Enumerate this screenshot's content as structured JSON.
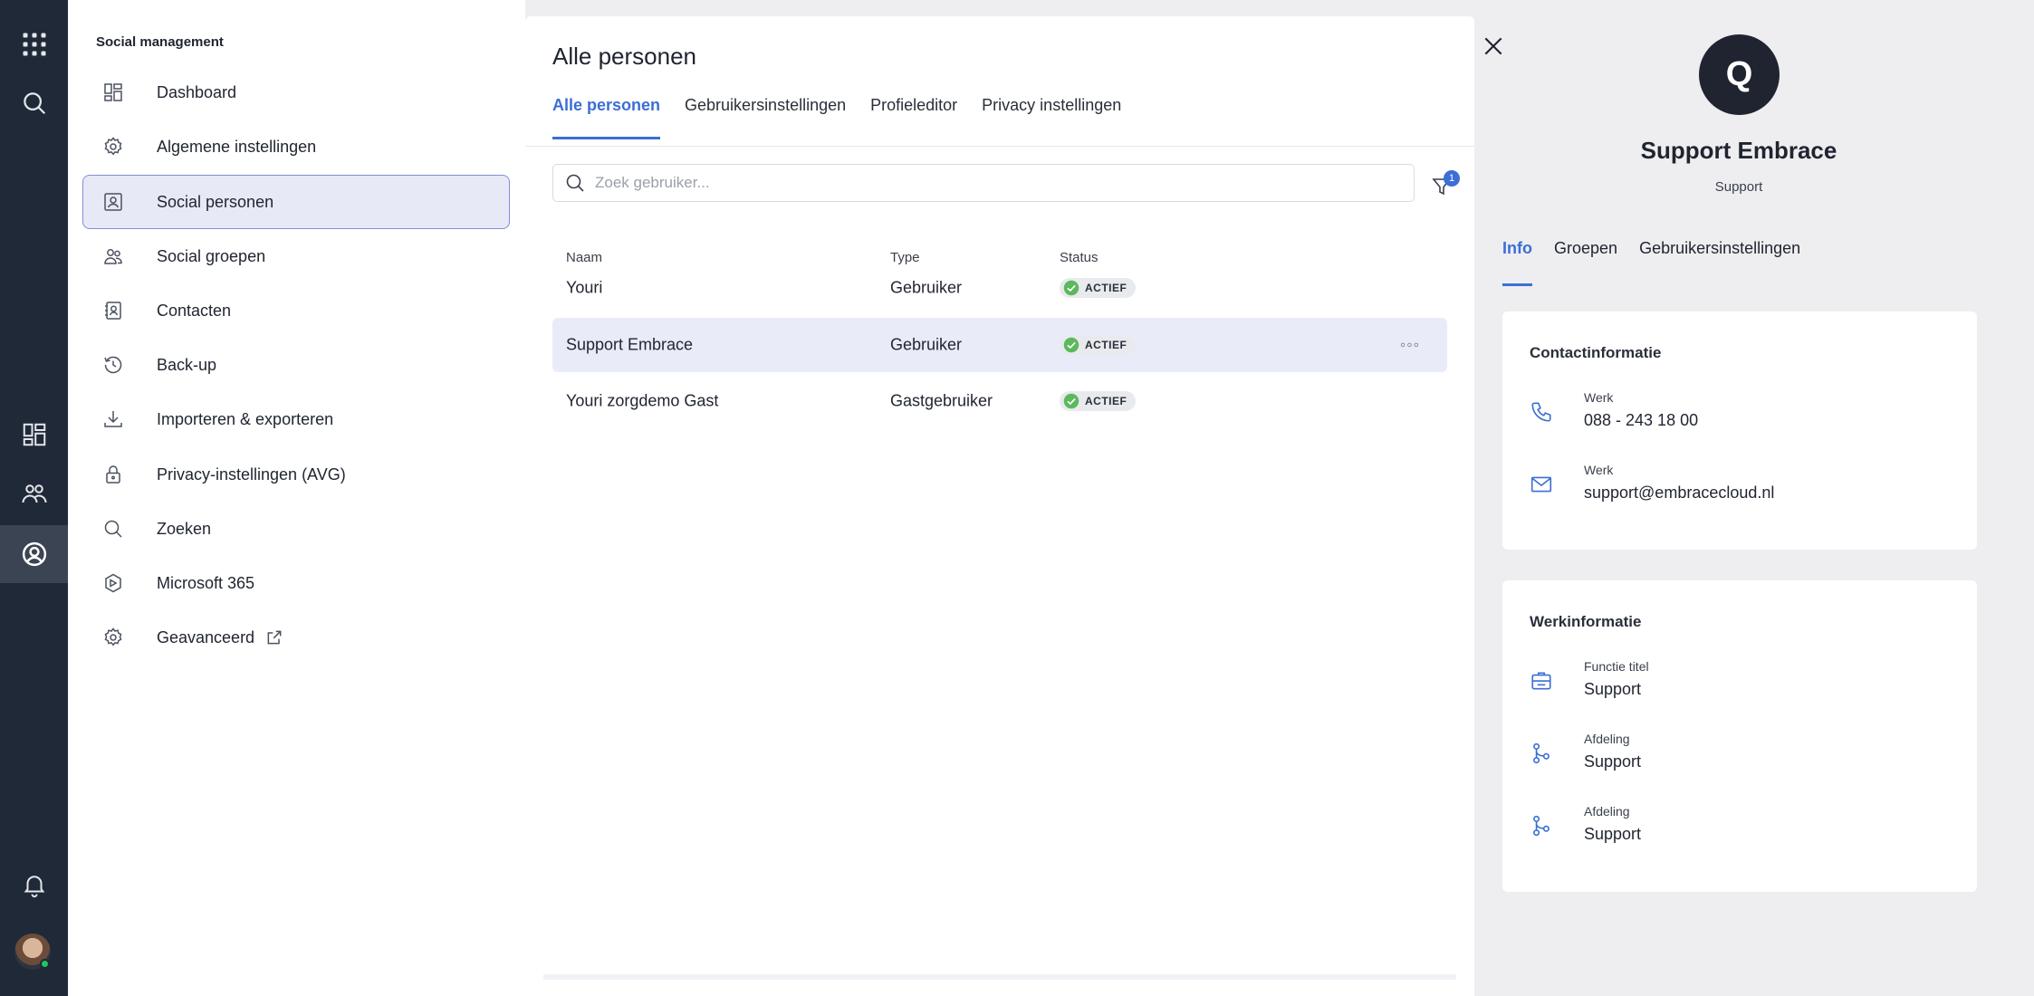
{
  "rail": {
    "items": [
      "apps-icon",
      "search-icon",
      "dashboard-icon",
      "people-icon",
      "social-persons-icon",
      "bell-icon"
    ]
  },
  "sidemenu": {
    "title": "Social management",
    "items": [
      {
        "label": "Dashboard",
        "icon": "dashboard-icon"
      },
      {
        "label": "Algemene instellingen",
        "icon": "gear-icon"
      },
      {
        "label": "Social personen",
        "icon": "person-card-icon",
        "active": true
      },
      {
        "label": "Social groepen",
        "icon": "group-icon"
      },
      {
        "label": "Contacten",
        "icon": "contacts-icon"
      },
      {
        "label": "Back-up",
        "icon": "history-icon"
      },
      {
        "label": "Importeren & exporteren",
        "icon": "download-icon"
      },
      {
        "label": "Privacy-instellingen (AVG)",
        "icon": "lock-icon"
      },
      {
        "label": "Zoeken",
        "icon": "search-icon"
      },
      {
        "label": "Microsoft 365",
        "icon": "m365-icon"
      },
      {
        "label": "Geavanceerd",
        "icon": "gear-icon"
      }
    ]
  },
  "center": {
    "title": "Alle personen",
    "tabs": [
      "Alle personen",
      "Gebruikersinstellingen",
      "Profieleditor",
      "Privacy instellingen"
    ],
    "search_placeholder": "Zoek gebruiker...",
    "filter_count": "1",
    "columns": [
      "Naam",
      "Type",
      "Status"
    ],
    "rows": [
      {
        "name": "Youri",
        "type": "Gebruiker",
        "status": "ACTIEF"
      },
      {
        "name": "Support Embrace",
        "type": "Gebruiker",
        "status": "ACTIEF"
      },
      {
        "name": "Youri zorgdemo Gast",
        "type": "Gastgebruiker",
        "status": "ACTIEF"
      }
    ],
    "more_label": "◦◦◦"
  },
  "profile": {
    "avatar_letter": "Q",
    "name": "Support Embrace",
    "subtitle": "Support",
    "tabs": [
      "Info",
      "Groepen",
      "Gebruikersinstellingen"
    ],
    "contact": {
      "title": "Contactinformatie",
      "items": [
        {
          "label": "Werk",
          "value": "088 - 243 18 00",
          "icon": "phone-icon"
        },
        {
          "label": "Werk",
          "value": "support@embracecloud.nl",
          "icon": "mail-icon"
        }
      ]
    },
    "work": {
      "title": "Werkinformatie",
      "items": [
        {
          "label": "Functie titel",
          "value": "Support",
          "icon": "briefcase-icon"
        },
        {
          "label": "Afdeling",
          "value": "Support",
          "icon": "department-icon"
        },
        {
          "label": "Afdeling",
          "value": "Support",
          "icon": "department-icon"
        }
      ]
    }
  },
  "colors": {
    "accent": "#3b6fd4",
    "rail": "#1f2937",
    "active_bg": "#e7eaf6",
    "status_check": "#5cb85c"
  }
}
